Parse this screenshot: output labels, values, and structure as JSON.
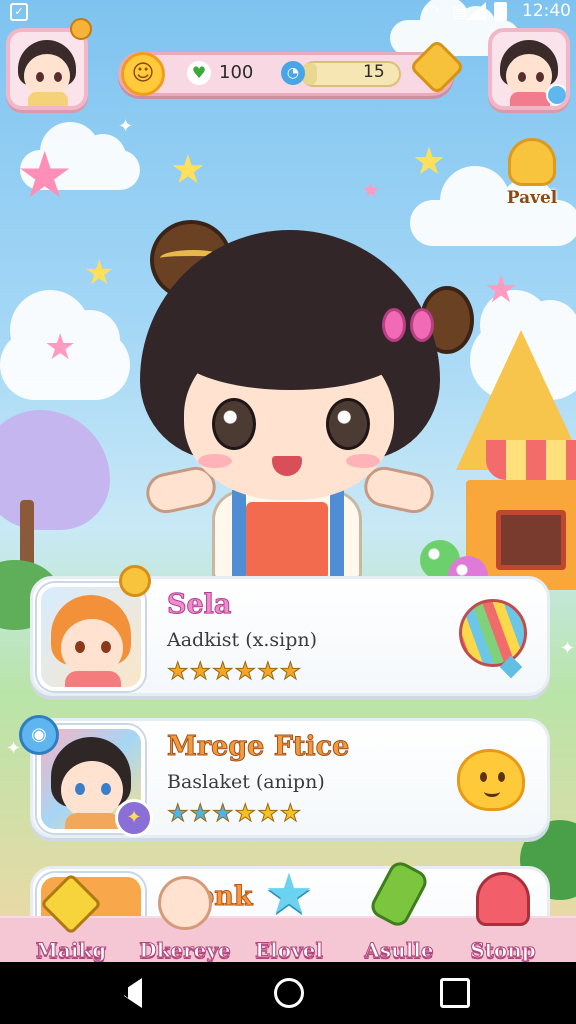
{
  "status_bar": {
    "time": "12:40",
    "icons": [
      "app-notification-icon",
      "wifi-icon",
      "sim-icon",
      "signal-icon",
      "battery-icon"
    ]
  },
  "hud": {
    "left_avatar": "player-avatar",
    "right_avatar": "friend-avatar",
    "hearts_value": "100",
    "timer_value": "15",
    "timer_progress": 0.15
  },
  "side_button": {
    "label": "Pavel",
    "icon": "crown-icon"
  },
  "cards": [
    {
      "name": "Sela",
      "subtitle": "Aadkist (x.sipn)",
      "stars_total": 6,
      "star_color": "#f5a623",
      "item_icon": "balloon-icon"
    },
    {
      "name": "Mrege Ftice",
      "subtitle": "Baslaket (anipn)",
      "stars_total": 6,
      "star_color_primary": "#4fb3ea",
      "star_color_secondary": "#f5c023",
      "item_icon": "smiley-blob-icon"
    },
    {
      "name": "Lionk"
    }
  ],
  "bottom_nav": [
    {
      "label": "Maikg",
      "icon": "diamond-icon"
    },
    {
      "label": "Dkereye",
      "icon": "character-icon"
    },
    {
      "label": "Elovel",
      "icon": "star-icon"
    },
    {
      "label": "Asulle",
      "icon": "bottle-icon"
    },
    {
      "label": "Stonp",
      "icon": "cake-icon"
    }
  ],
  "colors": {
    "sky_top": "#7ec3f0",
    "nav_bg": "#f5c7d4",
    "accent_pink": "#f08bd0",
    "accent_orange": "#f59a3c"
  }
}
